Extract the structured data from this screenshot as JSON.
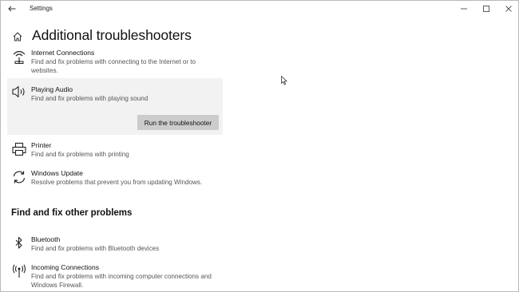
{
  "window": {
    "title": "Settings",
    "back_icon": "back-arrow-icon",
    "controls": [
      "minimize-icon",
      "maximize-icon",
      "close-icon"
    ]
  },
  "page": {
    "home_icon": "home-icon",
    "title": "Additional troubleshooters"
  },
  "troubleshooters": [
    {
      "icon": "wifi-icon",
      "name": "Internet Connections",
      "description": "Find and fix problems with connecting to the Internet or to websites."
    },
    {
      "icon": "speaker-icon",
      "name": "Playing Audio",
      "description": "Find and fix problems with playing sound",
      "selected": true,
      "button_label": "Run the troubleshooter"
    },
    {
      "icon": "printer-icon",
      "name": "Printer",
      "description": "Find and fix problems with printing"
    },
    {
      "icon": "sync-icon",
      "name": "Windows Update",
      "description": "Resolve problems that prevent you from updating Windows."
    }
  ],
  "other_section": {
    "title": "Find and fix other problems",
    "items": [
      {
        "icon": "bluetooth-icon",
        "name": "Bluetooth",
        "description": "Find and fix problems with Bluetooth devices"
      },
      {
        "icon": "antenna-icon",
        "name": "Incoming Connections",
        "description": "Find and fix problems with incoming computer connections and Windows Firewall."
      }
    ]
  },
  "colors": {
    "selected_bg": "#f2f2f2",
    "button_bg": "#cccccc",
    "secondary_text": "#555555"
  }
}
